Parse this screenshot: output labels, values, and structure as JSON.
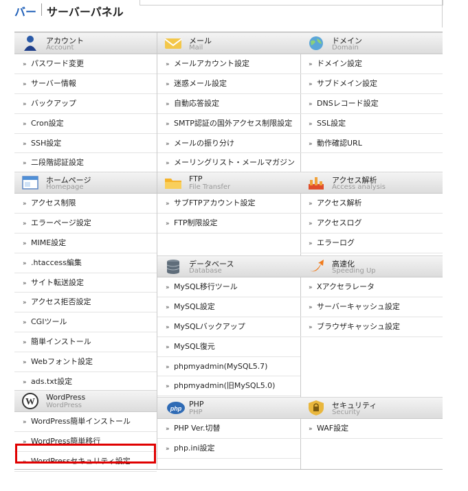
{
  "header": {
    "title_left": "バー",
    "title_main": "サーバーパネル"
  },
  "columns": [
    {
      "sections": [
        {
          "title": "アカウント",
          "subtitle": "Account",
          "icon": "account-icon",
          "items": [
            "パスワード変更",
            "サーバー情報",
            "バックアップ",
            "Cron設定",
            "SSH設定",
            "二段階認証設定"
          ]
        },
        {
          "title": "ホームページ",
          "subtitle": "Homepage",
          "icon": "homepage-icon",
          "items": [
            "アクセス制限",
            "エラーページ設定",
            "MIME設定",
            ".htaccess編集",
            "サイト転送設定",
            "アクセス拒否設定",
            "CGIツール",
            "簡単インストール",
            "Webフォント設定",
            "ads.txt設定"
          ]
        },
        {
          "title": "WordPress",
          "subtitle": "WordPress",
          "icon": "wordpress-icon",
          "items": [
            "WordPress簡単インストール",
            "WordPress簡単移行",
            "WordPressセキュリティ設定"
          ]
        }
      ]
    },
    {
      "sections": [
        {
          "title": "メール",
          "subtitle": "Mail",
          "icon": "mail-icon",
          "items": [
            "メールアカウント設定",
            "迷惑メール設定",
            "自動応答設定",
            "SMTP認証の国外アクセス制限設定",
            "メールの振り分け",
            "メーリングリスト・メールマガジン"
          ]
        },
        {
          "title": "FTP",
          "subtitle": "File Transfer",
          "icon": "folder-icon",
          "items": [
            "サブFTPアカウント設定",
            "FTP制限設定"
          ]
        },
        {
          "title": "データベース",
          "subtitle": "Database",
          "icon": "database-icon",
          "items": [
            "MySQL移行ツール",
            "MySQL設定",
            "MySQLバックアップ",
            "MySQL復元",
            "phpmyadmin(MySQL5.7)",
            "phpmyadmin(旧MySQL5.0)"
          ]
        },
        {
          "title": "PHP",
          "subtitle": "PHP",
          "icon": "php-icon",
          "items": [
            "PHP Ver.切替",
            "php.ini設定"
          ]
        }
      ]
    },
    {
      "sections": [
        {
          "title": "ドメイン",
          "subtitle": "Domain",
          "icon": "globe-icon",
          "items": [
            "ドメイン設定",
            "サブドメイン設定",
            "DNSレコード設定",
            "SSL設定",
            "動作確認URL"
          ]
        },
        {
          "title": "アクセス解析",
          "subtitle": "Access analysis",
          "icon": "analytics-icon",
          "items": [
            "アクセス解析",
            "アクセスログ",
            "エラーログ"
          ]
        },
        {
          "title": "高速化",
          "subtitle": "Speeding Up",
          "icon": "speed-icon",
          "items": [
            "Xアクセラレータ",
            "サーバーキャッシュ設定",
            "ブラウザキャッシュ設定"
          ]
        },
        {
          "title": "セキュリティ",
          "subtitle": "Security",
          "icon": "lock-icon",
          "items": [
            "WAF設定"
          ]
        }
      ]
    }
  ],
  "colors": {
    "accent": "#1f5fb8",
    "highlight": "#e00000"
  }
}
